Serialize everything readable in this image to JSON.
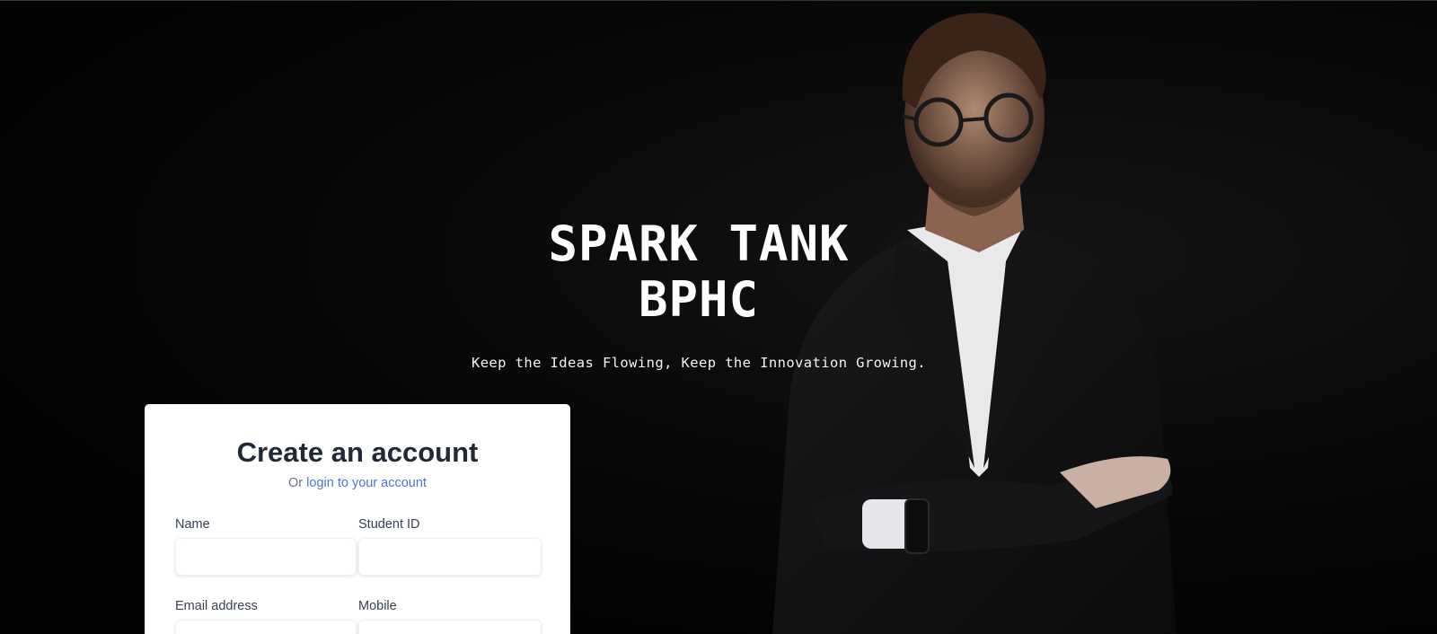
{
  "hero": {
    "title_line1": "SPARK TANK",
    "title_line2": "BPHC",
    "tagline": "Keep the Ideas Flowing, Keep the Innovation Growing."
  },
  "signup_form": {
    "title": "Create an account",
    "subtitle_prefix": "Or ",
    "login_link": "login to your account",
    "fields": {
      "name": {
        "label": "Name",
        "value": ""
      },
      "student_id": {
        "label": "Student ID",
        "value": ""
      },
      "email": {
        "label": "Email address",
        "value": ""
      },
      "mobile": {
        "label": "Mobile",
        "value": ""
      }
    }
  },
  "colors": {
    "link": "#4f73d9",
    "heading": "#1f2937",
    "background": "#050505"
  }
}
